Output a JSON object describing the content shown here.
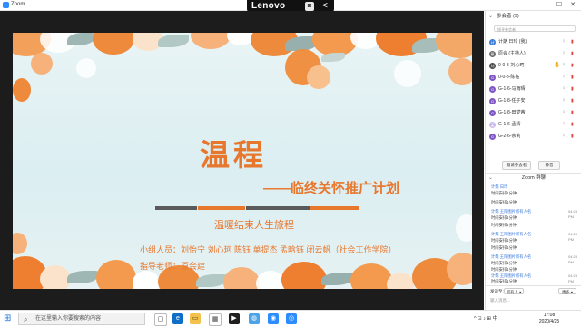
{
  "window": {
    "title": "Zoom",
    "minimize_glyph": "—",
    "maximize_glyph": "☐",
    "close_glyph": "✕"
  },
  "lenovo_bar": {
    "brand": "Lenovo",
    "camera_icon": "camera-person-icon",
    "collapse_glyph": "<"
  },
  "slide": {
    "title": "温程",
    "subtitle": "——临终关怀推广计划",
    "tagline": "温暖结束人生旅程",
    "members": "小组人员：刘怡宁  刘心珂  陈钰  单提杰  孟晗钰  闭云帆（社会工作学院）",
    "advisor": "指导老师：原会建",
    "accent_color": "#e8772e",
    "bar_colors": [
      "#5a5a5a",
      "#e8772e",
      "#5a5a5a",
      "#e8772e"
    ]
  },
  "participants": {
    "header": "参会者 (9)",
    "search_placeholder": "搜寻参会者",
    "items": [
      {
        "avatar_letter": "计",
        "avatar_color": "#3a7bd5",
        "name": "计蒴 日玲 (我)",
        "hand": false,
        "muted": true,
        "video_off": true
      },
      {
        "avatar_letter": "原",
        "avatar_color": "#6b6b6b",
        "name": "原会 (主持人)",
        "hand": false,
        "muted": true,
        "video_off": true
      },
      {
        "avatar_letter": "刘",
        "avatar_color": "#4a4a4a",
        "name": "0-0-8-刘心珂",
        "hand": true,
        "muted": false,
        "video_off": true
      },
      {
        "avatar_letter": "G",
        "avatar_color": "#7e57c2",
        "name": "0-0-8-陈钰",
        "hand": false,
        "muted": true,
        "video_off": true
      },
      {
        "avatar_letter": "G",
        "avatar_color": "#7e57c2",
        "name": "G-1-6-马雨晴",
        "hand": false,
        "muted": true,
        "video_off": true
      },
      {
        "avatar_letter": "G",
        "avatar_color": "#7e57c2",
        "name": "G-1-8-任子安",
        "hand": false,
        "muted": true,
        "video_off": true
      },
      {
        "avatar_letter": "G",
        "avatar_color": "#7e57c2",
        "name": "G-1-8-田梦茜",
        "hand": false,
        "muted": true,
        "video_off": true
      },
      {
        "avatar_letter": "孟",
        "avatar_color": "#c9b8e8",
        "name": "G-1-6-孟晴",
        "hand": false,
        "muted": true,
        "video_off": true
      },
      {
        "avatar_letter": "G",
        "avatar_color": "#7e57c2",
        "name": "G-2-6-余莉",
        "hand": false,
        "muted": true,
        "video_off": true
      }
    ],
    "invite_label": "邀请参会者",
    "mute_all_label": "静音"
  },
  "chat": {
    "header": "Zoom 群聊",
    "messages": [
      {
        "from": "计蒴 日玲",
        "text": "时间安排1分钟",
        "time": ""
      },
      {
        "from": "",
        "text": "时间安排1分钟",
        "time": ""
      },
      {
        "from": "计蒴 王阳图片所有人名",
        "text": "时间安排1分钟",
        "time": "04:23 PM"
      },
      {
        "from": "",
        "text": "时间安排1分钟",
        "time": ""
      },
      {
        "from": "计蒴 王阳图片所有人名",
        "text": "时间安排1分钟",
        "time": "04:23 PM"
      },
      {
        "from": "",
        "text": "时间安排1分钟",
        "time": ""
      },
      {
        "from": "计蒴 王阳图片所有人名",
        "text": "时间安排1分钟",
        "time": "04:23 PM"
      },
      {
        "from": "",
        "text": "时间安排1分钟",
        "time": ""
      },
      {
        "from": "计蒴 王阳图片所有人名",
        "text": "时间安排1分钟",
        "time": "04:23 PM"
      },
      {
        "from": "",
        "text": "时间安排1分钟",
        "time": ""
      }
    ],
    "to_label": "发送至:",
    "recipient": "所有人 ▾",
    "more_label": "更多 ▾",
    "input_placeholder": "输入消息..."
  },
  "taskbar": {
    "search_placeholder": "在这里输入你要搜索的内容",
    "tray_text": "^  ⊡  ♪  ⊞  中",
    "time": "17:08",
    "date": "2020/4/25"
  }
}
